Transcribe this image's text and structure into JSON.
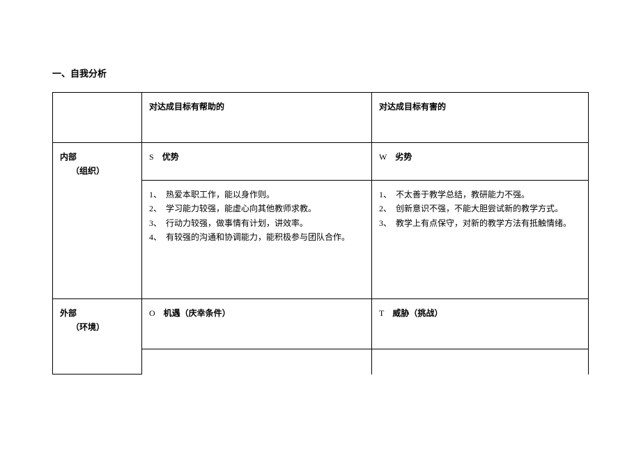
{
  "title": "一、自我分析",
  "header": {
    "col1": "",
    "col2": "对达成目标有帮助的",
    "col3": "对达成目标有害的"
  },
  "internal": {
    "label_line1": "内部",
    "label_line2": "（组织）",
    "s_letter": "S",
    "s_word": "优势",
    "w_letter": "W",
    "w_word": "劣势",
    "strengths": [
      "热爱本职工作，能以身作则。",
      "学习能力较强，能虚心向其他教师求教。",
      "行动力较强，做事情有计划，讲效率。",
      "有较强的沟通和协调能力，能积极参与团队合作。"
    ],
    "weaknesses": [
      "不太善于教学总结，教研能力不强。",
      "创新意识不强，不能大胆尝试新的教学方式。",
      "教学上有点保守，对新的教学方法有抵触情绪。"
    ]
  },
  "external": {
    "label_line1": "外部",
    "label_line2": "（环境）",
    "o_letter": "O",
    "o_word": "机遇（庆幸条件）",
    "t_letter": "T",
    "t_word": "威胁（挑战）"
  }
}
